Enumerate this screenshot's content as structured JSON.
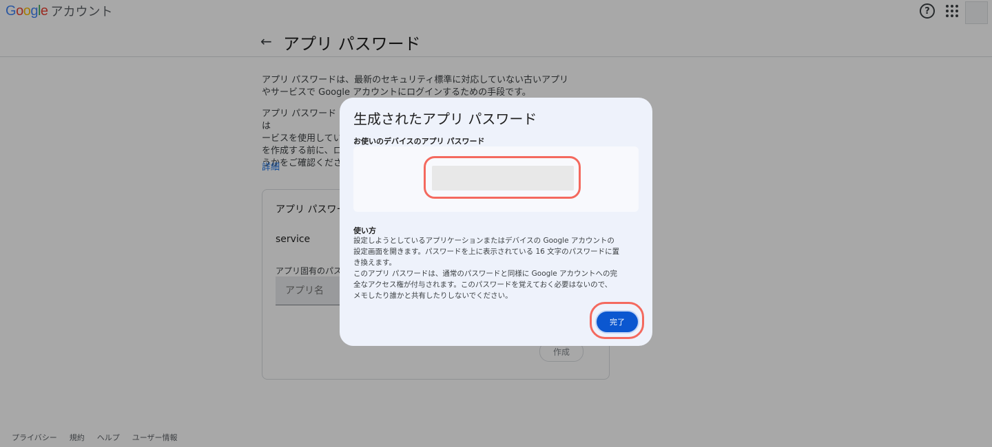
{
  "header": {
    "logo_text": "Google",
    "account_label": "アカウント",
    "help_icon": "help-circle-icon",
    "apps_icon": "apps-grid-icon"
  },
  "page": {
    "back_icon": "arrow-left-icon",
    "title": "アプリ パスワード",
    "paragraph1_line1": "アプリ パスワードは、最新のセキュリティ標準に対応していない古いアプリ",
    "paragraph1_line2": "やサービスで Google アカウントにログインするための手段です。",
    "paragraph2_line1": "アプリ パスワードは",
    "paragraph2_line2": "ービスを使用してい",
    "paragraph2_line3": "を作成する前に、ロ",
    "paragraph2_line4": "うかをご確認くださ",
    "more_link": "詳細",
    "card_title": "アプリ パスワー",
    "service_label": "service",
    "field_label": "アプリ固有のパス",
    "app_name_placeholder": "アプリ名",
    "create_button": "作成"
  },
  "footer": {
    "links": [
      "プライバシー",
      "規約",
      "ヘルプ",
      "ユーザー情報"
    ]
  },
  "dialog": {
    "title": "生成されたアプリ パスワード",
    "password_label": "お使いのデバイスのアプリ パスワード",
    "usage_title": "使い方",
    "usage_lines": [
      "設定しようとしているアプリケーションまたはデバイスの Google アカウントの",
      "設定画面を開きます。パスワードを上に表示されている 16 文字のパスワードに置",
      "き換えます。",
      "このアプリ パスワードは、通常のパスワードと同様に Google アカウントへの完",
      "全なアクセス権が付与されます。このパスワードを覚えておく必要はないので、",
      "メモしたり誰かと共有したりしないでください。"
    ],
    "done_button": "完了"
  },
  "colors": {
    "primary_button": "#0b57d0",
    "highlight_ring": "#f4695e",
    "dialog_bg": "#eef2fb",
    "link": "#1a73e8"
  }
}
